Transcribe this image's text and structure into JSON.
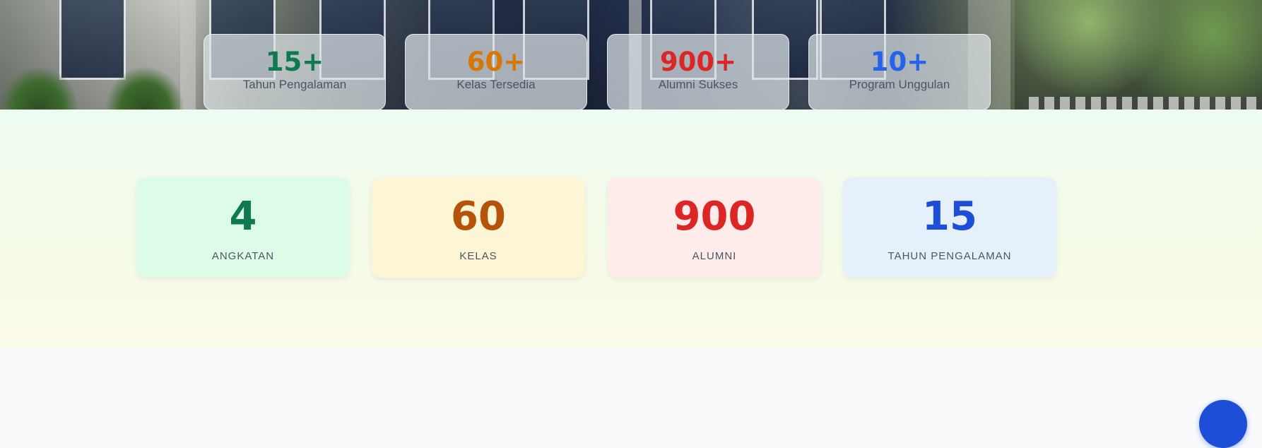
{
  "hero_stats": [
    {
      "value": "15+",
      "label": "Tahun Pengalaman",
      "color": "#0f7a4f"
    },
    {
      "value": "60+",
      "label": "Kelas Tersedia",
      "color": "#d97706"
    },
    {
      "value": "900+",
      "label": "Alumni Sukses",
      "color": "#dc2626"
    },
    {
      "value": "10+",
      "label": "Program Unggulan",
      "color": "#2563eb"
    }
  ],
  "band_stats": [
    {
      "value": "4",
      "label": "ANGKATAN",
      "color": "#0f7a4f",
      "bg": "#dcfce7"
    },
    {
      "value": "60",
      "label": "KELAS",
      "color": "#b45309",
      "bg": "#fdf6d6"
    },
    {
      "value": "900",
      "label": "ALUMNI",
      "color": "#dc2626",
      "bg": "#fdecea"
    },
    {
      "value": "15",
      "label": "TAHUN PENGALAMAN",
      "color": "#1d4ed8",
      "bg": "#e6f0fb"
    }
  ],
  "fab": {
    "icon": "chat-icon",
    "color": "#1d4ed8"
  }
}
